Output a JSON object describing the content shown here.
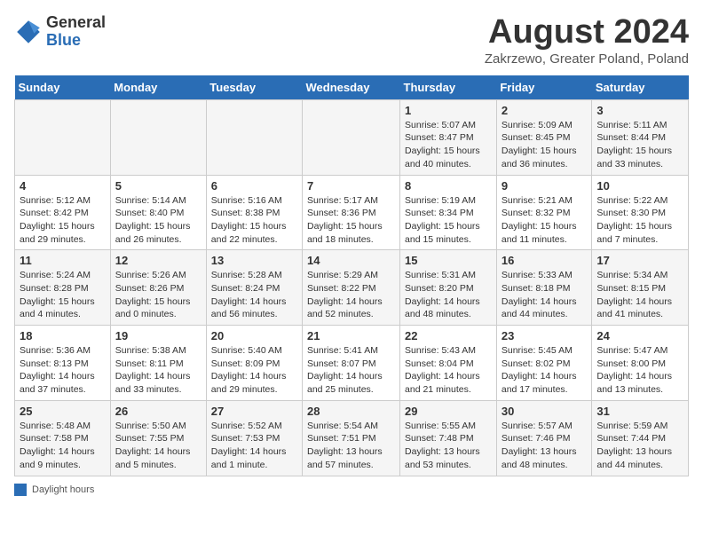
{
  "logo": {
    "general": "General",
    "blue": "Blue"
  },
  "title": "August 2024",
  "location": "Zakrzewo, Greater Poland, Poland",
  "days_of_week": [
    "Sunday",
    "Monday",
    "Tuesday",
    "Wednesday",
    "Thursday",
    "Friday",
    "Saturday"
  ],
  "legend_label": "Daylight hours",
  "weeks": [
    [
      {
        "num": "",
        "info": ""
      },
      {
        "num": "",
        "info": ""
      },
      {
        "num": "",
        "info": ""
      },
      {
        "num": "",
        "info": ""
      },
      {
        "num": "1",
        "info": "Sunrise: 5:07 AM\nSunset: 8:47 PM\nDaylight: 15 hours and 40 minutes."
      },
      {
        "num": "2",
        "info": "Sunrise: 5:09 AM\nSunset: 8:45 PM\nDaylight: 15 hours and 36 minutes."
      },
      {
        "num": "3",
        "info": "Sunrise: 5:11 AM\nSunset: 8:44 PM\nDaylight: 15 hours and 33 minutes."
      }
    ],
    [
      {
        "num": "4",
        "info": "Sunrise: 5:12 AM\nSunset: 8:42 PM\nDaylight: 15 hours and 29 minutes."
      },
      {
        "num": "5",
        "info": "Sunrise: 5:14 AM\nSunset: 8:40 PM\nDaylight: 15 hours and 26 minutes."
      },
      {
        "num": "6",
        "info": "Sunrise: 5:16 AM\nSunset: 8:38 PM\nDaylight: 15 hours and 22 minutes."
      },
      {
        "num": "7",
        "info": "Sunrise: 5:17 AM\nSunset: 8:36 PM\nDaylight: 15 hours and 18 minutes."
      },
      {
        "num": "8",
        "info": "Sunrise: 5:19 AM\nSunset: 8:34 PM\nDaylight: 15 hours and 15 minutes."
      },
      {
        "num": "9",
        "info": "Sunrise: 5:21 AM\nSunset: 8:32 PM\nDaylight: 15 hours and 11 minutes."
      },
      {
        "num": "10",
        "info": "Sunrise: 5:22 AM\nSunset: 8:30 PM\nDaylight: 15 hours and 7 minutes."
      }
    ],
    [
      {
        "num": "11",
        "info": "Sunrise: 5:24 AM\nSunset: 8:28 PM\nDaylight: 15 hours and 4 minutes."
      },
      {
        "num": "12",
        "info": "Sunrise: 5:26 AM\nSunset: 8:26 PM\nDaylight: 15 hours and 0 minutes."
      },
      {
        "num": "13",
        "info": "Sunrise: 5:28 AM\nSunset: 8:24 PM\nDaylight: 14 hours and 56 minutes."
      },
      {
        "num": "14",
        "info": "Sunrise: 5:29 AM\nSunset: 8:22 PM\nDaylight: 14 hours and 52 minutes."
      },
      {
        "num": "15",
        "info": "Sunrise: 5:31 AM\nSunset: 8:20 PM\nDaylight: 14 hours and 48 minutes."
      },
      {
        "num": "16",
        "info": "Sunrise: 5:33 AM\nSunset: 8:18 PM\nDaylight: 14 hours and 44 minutes."
      },
      {
        "num": "17",
        "info": "Sunrise: 5:34 AM\nSunset: 8:15 PM\nDaylight: 14 hours and 41 minutes."
      }
    ],
    [
      {
        "num": "18",
        "info": "Sunrise: 5:36 AM\nSunset: 8:13 PM\nDaylight: 14 hours and 37 minutes."
      },
      {
        "num": "19",
        "info": "Sunrise: 5:38 AM\nSunset: 8:11 PM\nDaylight: 14 hours and 33 minutes."
      },
      {
        "num": "20",
        "info": "Sunrise: 5:40 AM\nSunset: 8:09 PM\nDaylight: 14 hours and 29 minutes."
      },
      {
        "num": "21",
        "info": "Sunrise: 5:41 AM\nSunset: 8:07 PM\nDaylight: 14 hours and 25 minutes."
      },
      {
        "num": "22",
        "info": "Sunrise: 5:43 AM\nSunset: 8:04 PM\nDaylight: 14 hours and 21 minutes."
      },
      {
        "num": "23",
        "info": "Sunrise: 5:45 AM\nSunset: 8:02 PM\nDaylight: 14 hours and 17 minutes."
      },
      {
        "num": "24",
        "info": "Sunrise: 5:47 AM\nSunset: 8:00 PM\nDaylight: 14 hours and 13 minutes."
      }
    ],
    [
      {
        "num": "25",
        "info": "Sunrise: 5:48 AM\nSunset: 7:58 PM\nDaylight: 14 hours and 9 minutes."
      },
      {
        "num": "26",
        "info": "Sunrise: 5:50 AM\nSunset: 7:55 PM\nDaylight: 14 hours and 5 minutes."
      },
      {
        "num": "27",
        "info": "Sunrise: 5:52 AM\nSunset: 7:53 PM\nDaylight: 14 hours and 1 minute."
      },
      {
        "num": "28",
        "info": "Sunrise: 5:54 AM\nSunset: 7:51 PM\nDaylight: 13 hours and 57 minutes."
      },
      {
        "num": "29",
        "info": "Sunrise: 5:55 AM\nSunset: 7:48 PM\nDaylight: 13 hours and 53 minutes."
      },
      {
        "num": "30",
        "info": "Sunrise: 5:57 AM\nSunset: 7:46 PM\nDaylight: 13 hours and 48 minutes."
      },
      {
        "num": "31",
        "info": "Sunrise: 5:59 AM\nSunset: 7:44 PM\nDaylight: 13 hours and 44 minutes."
      }
    ]
  ]
}
